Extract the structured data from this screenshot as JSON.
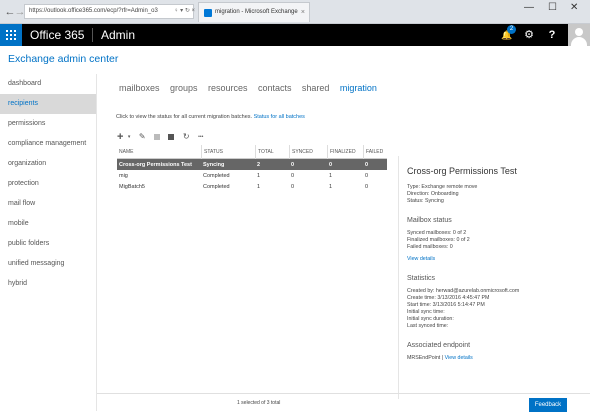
{
  "browser": {
    "url": "https://outlook.office365.com/ecp/?rfr=Admin_o3",
    "addr_icons": "♀ ▾ ↻ ×",
    "tab_title": "migration - Microsoft Exchange",
    "tab_close": "×",
    "back": "←",
    "forward": "→",
    "minimize": "—",
    "maximize": "☐",
    "close": "✕",
    "right_icons": "⌂ ☆ ⚙"
  },
  "topbar": {
    "brand": "Office 365",
    "app": "Admin",
    "notif_count": "2",
    "bell_glyph": "🔔",
    "gear_glyph": "⚙",
    "help_glyph": "?"
  },
  "header": {
    "title": "Exchange admin center"
  },
  "leftnav": [
    {
      "label": "dashboard",
      "active": false
    },
    {
      "label": "recipients",
      "active": true
    },
    {
      "label": "permissions",
      "active": false
    },
    {
      "label": "compliance management",
      "active": false
    },
    {
      "label": "organization",
      "active": false
    },
    {
      "label": "protection",
      "active": false
    },
    {
      "label": "mail flow",
      "active": false
    },
    {
      "label": "mobile",
      "active": false
    },
    {
      "label": "public folders",
      "active": false
    },
    {
      "label": "unified messaging",
      "active": false
    },
    {
      "label": "hybrid",
      "active": false
    }
  ],
  "subnav": [
    {
      "label": "mailboxes",
      "active": false
    },
    {
      "label": "groups",
      "active": false
    },
    {
      "label": "resources",
      "active": false
    },
    {
      "label": "contacts",
      "active": false
    },
    {
      "label": "shared",
      "active": false
    },
    {
      "label": "migration",
      "active": true
    }
  ],
  "info": {
    "text": "Click to view the status for all current migration batches.",
    "link": "Status for all batches"
  },
  "toolbar": {
    "add": "+",
    "add_caret": "▾",
    "edit": "✎",
    "refresh": "↻",
    "more": "•••"
  },
  "grid": {
    "headers": [
      "NAME",
      "STATUS",
      "TOTAL",
      "SYNCED",
      "FINALIZED",
      "FAILED"
    ],
    "rows": [
      [
        "Cross-org Permissions Test",
        "Syncing",
        "2",
        "0",
        "0",
        "0"
      ],
      [
        "mig",
        "Completed",
        "1",
        "0",
        "1",
        "0"
      ],
      [
        "MigBatch5",
        "Completed",
        "1",
        "0",
        "1",
        "0"
      ]
    ]
  },
  "details": {
    "title": "Cross-org Permissions Test",
    "type": "Type: Exchange remote move",
    "direction": "Direction: Onboarding",
    "status": "Status: Syncing",
    "mailbox_status_heading": "Mailbox status",
    "synced": "Synced mailboxes: 0 of 2",
    "finalized": "Finalized mailboxes: 0 of 2",
    "failed": "Failed mailboxes: 0",
    "view_details": "View details",
    "statistics_heading": "Statistics",
    "created_by": "Created by: herwad@azurelab.onmicrosoft.com",
    "create_time": "Create time: 3/13/2016 4:45:47 PM",
    "start_time": "Start time: 3/13/2016 5:14:47 PM",
    "initial_sync_time": "Initial sync time:",
    "initial_sync_duration": "Initial sync duration:",
    "last_synced_time": "Last synced time:",
    "endpoint_heading": "Associated endpoint",
    "endpoint_name": "MRSEndPoint",
    "endpoint_sep": "|",
    "endpoint_link": "View details"
  },
  "footer": {
    "count": "1 selected of 3 total",
    "feedback": "Feedback"
  }
}
